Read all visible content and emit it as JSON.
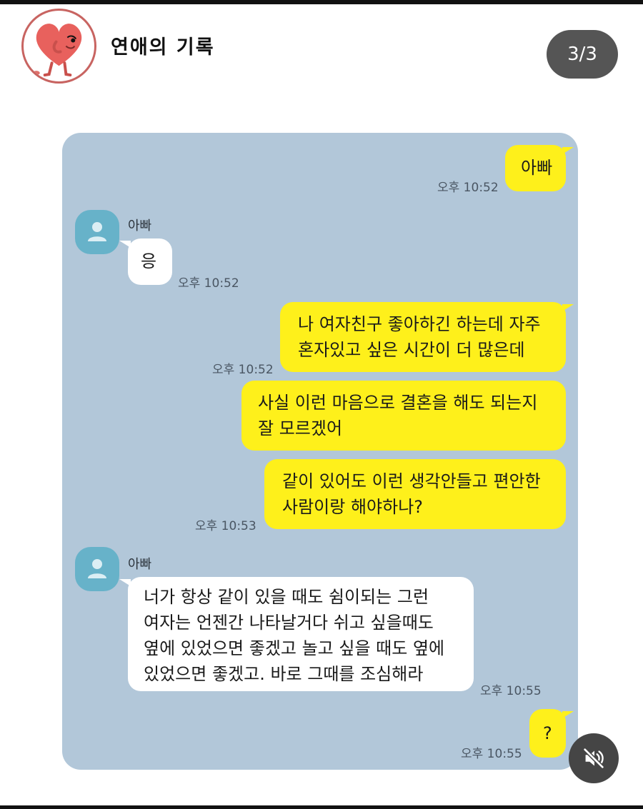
{
  "header": {
    "channel_name": "연애의 기록",
    "page_counter": "3/3"
  },
  "chat": {
    "friend_name": "아빠",
    "messages": [
      {
        "sender": "me",
        "text_lines": [
          "아빠"
        ],
        "time": "오후 10:52"
      },
      {
        "sender": "other",
        "name": "아빠",
        "text_lines": [
          "응"
        ],
        "time": "오후 10:52"
      },
      {
        "sender": "me",
        "text_lines": [
          "나 여자친구 좋아하긴 하는데 자주",
          "혼자있고 싶은 시간이 더 많은데"
        ],
        "time": "오후 10:52"
      },
      {
        "sender": "me",
        "text_lines": [
          "사실 이런 마음으로 결혼을 해도 되는지",
          "잘 모르겠어"
        ],
        "time": ""
      },
      {
        "sender": "me",
        "text_lines": [
          "같이 있어도 이런 생각안들고 편안한",
          "사람이랑 해야하나?"
        ],
        "time": "오후 10:53"
      },
      {
        "sender": "other",
        "name": "아빠",
        "text_lines": [
          "너가 항상 같이 있을 때도 쉼이되는 그런",
          "여자는 언젠간 나타날거다 쉬고 싶을때도",
          "옆에 있었으면 좋겠고 놀고 싶을 때도 옆에",
          "있었으면 좋겠고. 바로 그때를 조심해라"
        ],
        "time": "오후 10:55"
      },
      {
        "sender": "me",
        "text_lines": [
          "?"
        ],
        "time": "오후 10:55"
      }
    ]
  },
  "icons": {
    "profile": "heart-character-icon",
    "friend_avatar": "default-person-icon",
    "mute": "speaker-muted-icon"
  },
  "colors": {
    "chat_background": "#b2c7d9",
    "my_bubble": "#fef01b",
    "other_bubble": "#ffffff",
    "friend_avatar": "#67b2c9",
    "page_counter_bg": "#555555",
    "profile_ring": "#c86461"
  }
}
